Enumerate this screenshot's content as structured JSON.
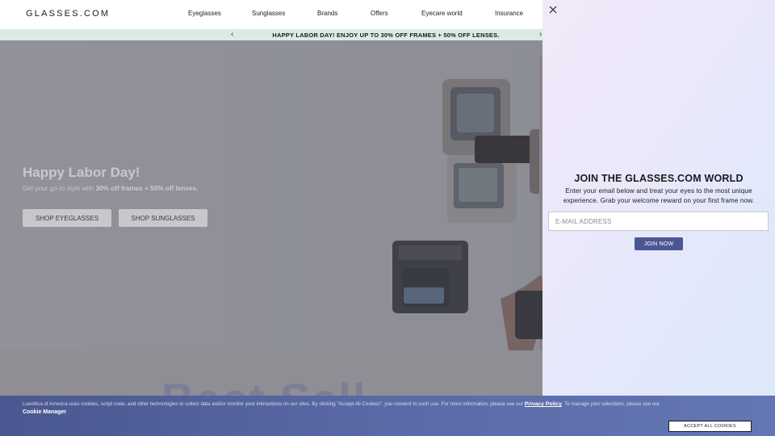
{
  "header": {
    "logo": "GLASSES.COM",
    "nav": [
      {
        "label": "Eyeglasses",
        "name": "nav-eyeglasses"
      },
      {
        "label": "Sunglasses",
        "name": "nav-sunglasses"
      },
      {
        "label": "Brands",
        "name": "nav-brands"
      },
      {
        "label": "Offers",
        "name": "nav-offers"
      },
      {
        "label": "Eyecare world",
        "name": "nav-eyecare-world"
      },
      {
        "label": "Insurance",
        "name": "nav-insurance"
      }
    ]
  },
  "promo": {
    "text": "HAPPY LABOR DAY! ENJOY UP TO 30% OFF FRAMES + 50% OFF LENSES.",
    "prev_icon": "chevron-left-icon",
    "next_icon": "chevron-right-icon"
  },
  "hero": {
    "title": "Happy Labor Day!",
    "subtitle_prefix": "Get your go-to style with ",
    "subtitle_bold": "30% off frames + 50% off lenses.",
    "buttons": [
      "SHOP EYEGLASSES",
      "SHOP SUNGLASSES"
    ]
  },
  "below": {
    "big_word": "Best Sell"
  },
  "signup": {
    "close_icon": "close-icon",
    "title": "JOIN THE GLASSES.COM WORLD",
    "subtitle": "Enter your email below and treat your eyes to the most unique experience. Grab your welcome reward on your first frame now.",
    "email_placeholder": "E-MAIL ADDRESS",
    "button": "JOIN NOW"
  },
  "cookie": {
    "text_before": "Luxottica of America uses cookies, script code, and other technologies to collect data and/or monitor your interactions on our sites. By clicking \"Accept All Cookies\", you consent to such use. For more information, please see our ",
    "privacy_link": "Privacy Policy",
    "text_after": ". To manage your selections, please see our",
    "manager_link": "Cookie Manager",
    "accept_button": "ACCEPT ALL COOKIES"
  },
  "colors": {
    "promo_bg": "#dbeae7",
    "join_button": "#4b5694",
    "cookie_bg": "#5a6aa6"
  }
}
